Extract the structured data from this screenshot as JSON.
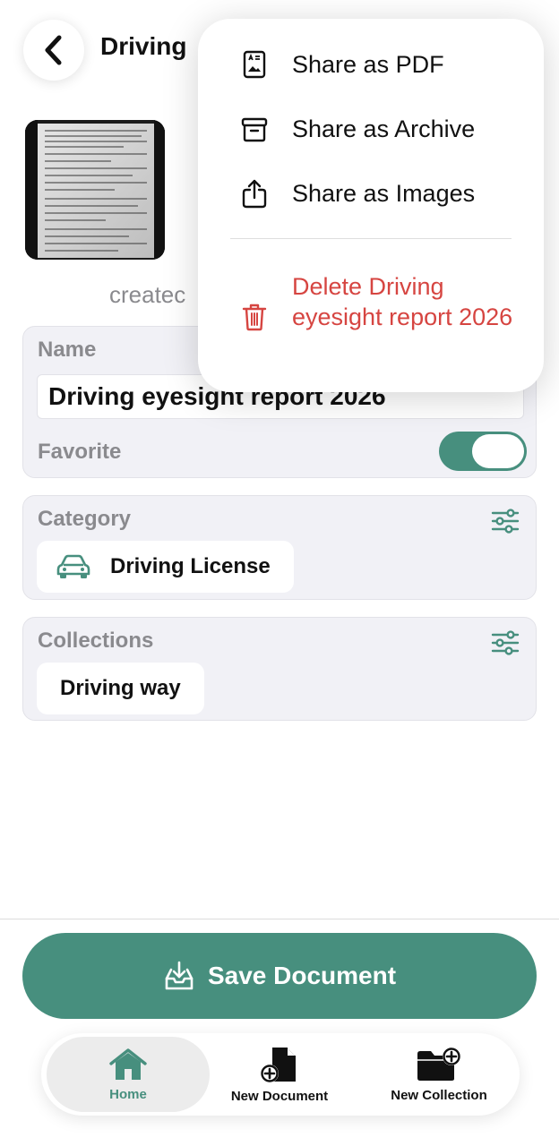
{
  "header": {
    "title": "Driving",
    "back_icon": "chevron-left-icon"
  },
  "document": {
    "created_text": "createc"
  },
  "name_card": {
    "label": "Name",
    "value": "Driving eyesight report 2026",
    "favorite_label": "Favorite",
    "favorite_on": true
  },
  "category_card": {
    "label": "Category",
    "selected": "Driving License",
    "selected_icon": "car-icon",
    "filter_icon": "sliders-icon"
  },
  "collections_card": {
    "label": "Collections",
    "selected": "Driving way",
    "filter_icon": "sliders-icon"
  },
  "save_button": {
    "label": "Save Document",
    "icon": "tray-download-icon"
  },
  "tabbar": {
    "items": [
      {
        "label": "Home",
        "icon": "home-icon",
        "active": true
      },
      {
        "label": "New Document",
        "icon": "new-document-icon",
        "active": false
      },
      {
        "label": "New Collection",
        "icon": "new-folder-icon",
        "active": false
      }
    ]
  },
  "menu": {
    "items": [
      {
        "label": "Share as PDF",
        "icon": "pdf-document-icon"
      },
      {
        "label": "Share as Archive",
        "icon": "archive-box-icon"
      },
      {
        "label": "Share as Images",
        "icon": "share-icon"
      }
    ],
    "delete_label": "Delete Driving eyesight report 2026",
    "delete_icon": "trash-icon"
  },
  "colors": {
    "accent": "#478f7e",
    "danger": "#d64541",
    "muted_text": "#8a8a8e",
    "card_bg": "#f1f1f6"
  }
}
